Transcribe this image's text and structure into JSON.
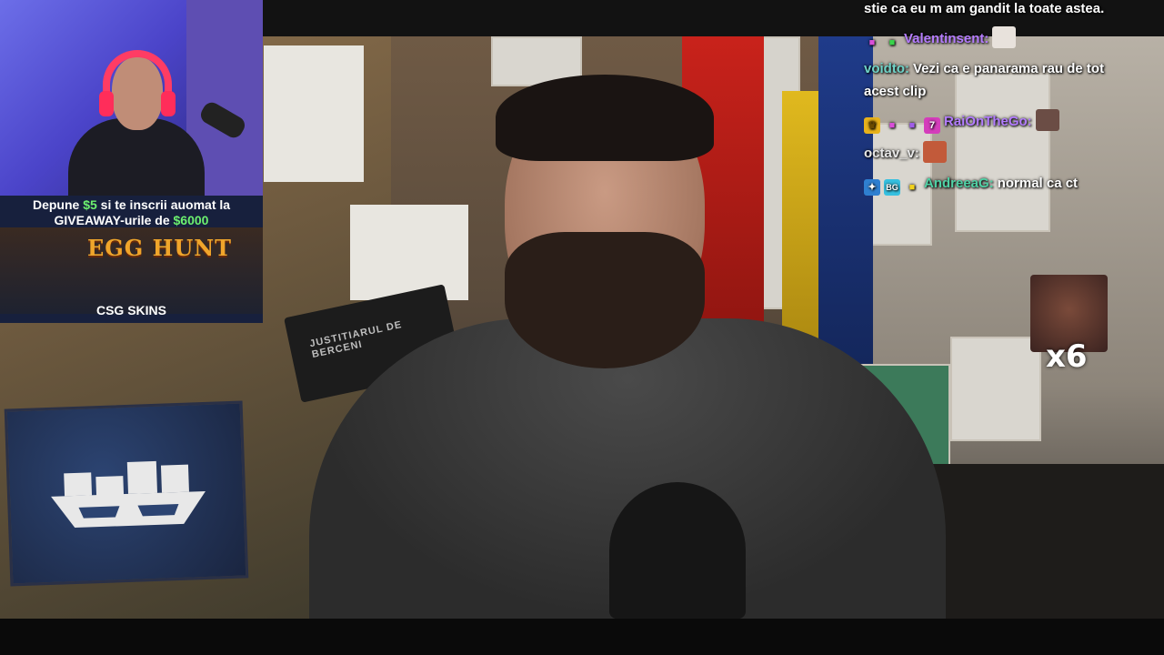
{
  "webcam": {
    "promo_prefix": "Depune ",
    "promo_amount": "$5",
    "promo_suffix": " si te inscrii auomat la",
    "promo_line2_a": "GIVEAWAY",
    "promo_line2_b": "-urile de ",
    "promo_line2_amount": "$6000",
    "event_title": "EGG HUNT",
    "brand": "CSG SKINS"
  },
  "background": {
    "sign_text": "JUSTITIARUL DE BERCENI"
  },
  "chat": {
    "messages": [
      {
        "user": "",
        "text": "stie ca eu m am gandit la toate astea.",
        "color": "#ffffff"
      },
      {
        "user": "Valentinsent:",
        "text": "",
        "color": "#b57cff"
      },
      {
        "user": "voidto:",
        "text": "Vezi ca e panarama rau de tot",
        "text2": "acest clip",
        "color": "#6fd3c8"
      },
      {
        "user": "RaiOnTheGo:",
        "text": "",
        "color": "#b37cff"
      },
      {
        "user": "octav_v:",
        "text": "",
        "color": "#e8e8e8"
      },
      {
        "user": "AndreeaG:",
        "text": "normal ca ct",
        "color": "#4fd1a5"
      }
    ],
    "emote_combo": "x6"
  },
  "colors": {
    "accent_green": "#6cf06f",
    "chat_purple": "#b57cff"
  }
}
